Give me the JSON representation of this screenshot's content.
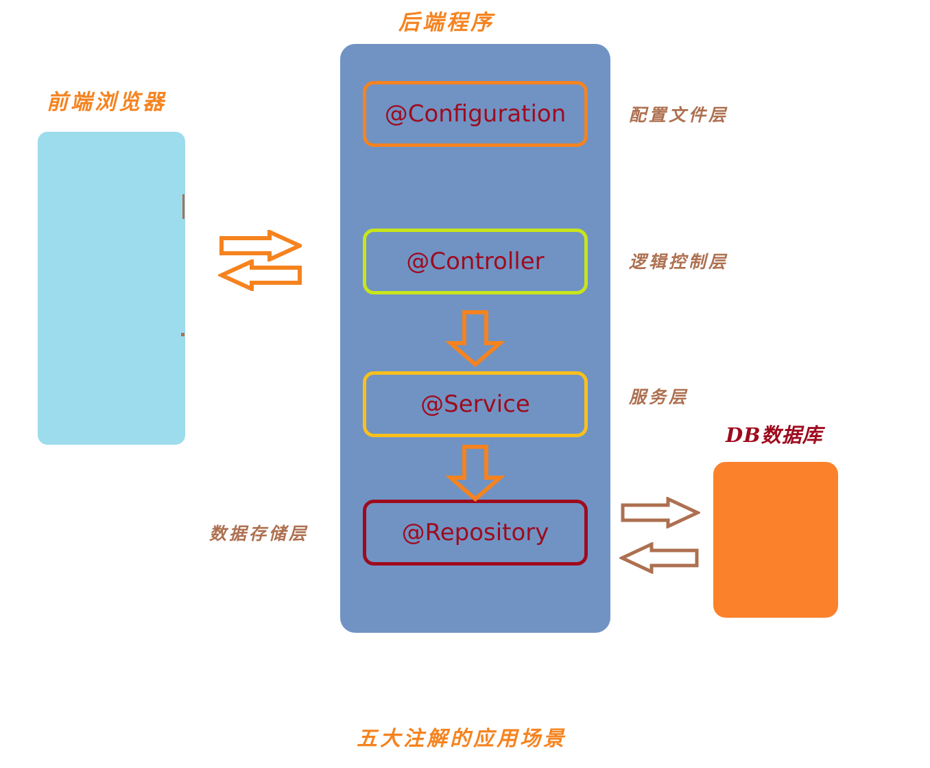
{
  "diagram": {
    "bottom_caption": "五大注解的应用场景"
  },
  "frontend": {
    "title": "前端浏览器",
    "box_color": "#9ddcec"
  },
  "backend": {
    "title": "后端程序",
    "panel_color": "#7093c4",
    "annotations": [
      {
        "label": "@Configuration",
        "border_color": "#f5831f",
        "layer_label": "配置文件层"
      },
      {
        "label": "@Controller",
        "border_color": "#c8e51b",
        "layer_label": "逻辑控制层"
      },
      {
        "label": "@Service",
        "border_color": "#f9c01c",
        "layer_label": "服务层"
      },
      {
        "label": "@Repository",
        "border_color": "#9e0b1e",
        "layer_label": "数据存储层"
      }
    ]
  },
  "database": {
    "title": "DB数据库",
    "box_color": "#fb812a"
  },
  "arrows": {
    "frontend_to_backend": "arrow-right-icon",
    "backend_to_frontend": "arrow-left-icon",
    "controller_to_service": "arrow-down-icon",
    "service_to_repository": "arrow-down-icon",
    "repository_to_db": "arrow-right-icon",
    "db_to_repository": "arrow-left-icon",
    "orange_color": "#f5831f",
    "brown_color": "#ad7050"
  },
  "text_colors": {
    "orange_title": "#f5831f",
    "brown_label": "#ad7050",
    "dark_red": "#9e0b1e"
  }
}
